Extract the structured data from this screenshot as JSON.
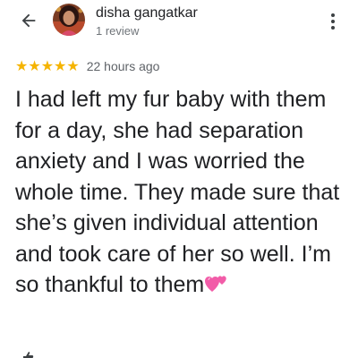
{
  "reviewer": {
    "name": "disha gangatkar",
    "review_count": "1 review"
  },
  "review": {
    "rating": 5,
    "rating_max": 5,
    "stars": [
      "★",
      "★",
      "★",
      "★",
      "★"
    ],
    "time_ago": "22 hours ago",
    "text": "I had left my fur baby with them for a day, she had separation anxiety and I was worried the whole time. They made sure that she’s given individual attention and took care of her so well. I’m so thankful to them"
  },
  "icons": {
    "back": "back-arrow-icon",
    "more": "more-vertical-icon",
    "heart": "two-hearts-emoji",
    "thumb": "thumbs-up-icon"
  },
  "colors": {
    "star": "#f5b400",
    "text_primary": "#202124",
    "text_secondary": "#70757a",
    "heart": "#f25ca8"
  }
}
